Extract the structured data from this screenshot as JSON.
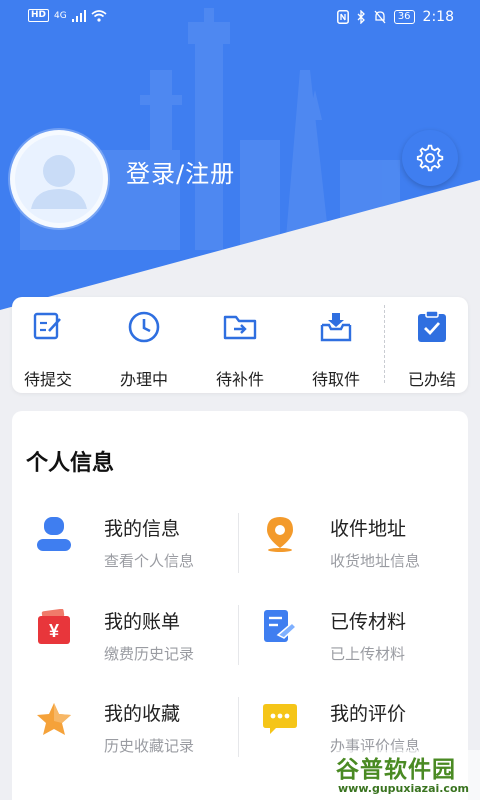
{
  "status_bar": {
    "left_badge": "HD",
    "network": "4G",
    "battery": "36",
    "time": "2:18"
  },
  "profile": {
    "login_label": "登录/注册"
  },
  "quick_actions": [
    {
      "label": "待提交",
      "icon": "edit-document-icon"
    },
    {
      "label": "办理中",
      "icon": "clock-icon"
    },
    {
      "label": "待补件",
      "icon": "folder-arrow-icon"
    },
    {
      "label": "待取件",
      "icon": "inbox-download-icon"
    },
    {
      "label": "已办结",
      "icon": "clipboard-check-icon"
    }
  ],
  "personal_info": {
    "title": "个人信息",
    "items": [
      {
        "title": "我的信息",
        "subtitle": "查看个人信息",
        "icon": "user-icon",
        "color": "#3f7ef0"
      },
      {
        "title": "收件地址",
        "subtitle": "收货地址信息",
        "icon": "location-pin-icon",
        "color": "#f39a2b"
      },
      {
        "title": "我的账单",
        "subtitle": "缴费历史记录",
        "icon": "wallet-yen-icon",
        "color": "#e8363b"
      },
      {
        "title": "已传材料",
        "subtitle": "已上传材料",
        "icon": "document-upload-icon",
        "color": "#3f7ef0"
      },
      {
        "title": "我的收藏",
        "subtitle": "历史收藏记录",
        "icon": "star-icon",
        "color": "#f5a23a"
      },
      {
        "title": "我的评价",
        "subtitle": "办事评价信息",
        "icon": "chat-bubble-icon",
        "color": "#f5c518"
      }
    ]
  },
  "watermark": {
    "brand": "谷普软件园",
    "url": "www.gupuxiazai.com"
  },
  "colors": {
    "primary": "#3f7ef0",
    "background": "#eeeff3"
  }
}
